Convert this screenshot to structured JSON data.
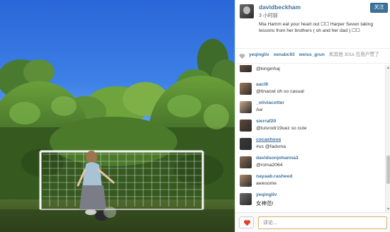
{
  "post": {
    "username": "davidbeckham",
    "time_ago": "3 小时前",
    "follow_label": "关注",
    "caption": "Mia Hamm eat your heart out ☐☐ Harper Seven taking lessons from her brothers ( oh and her dad ) ☐☐"
  },
  "likes": {
    "users": [
      "yeqingliv",
      "xenabc93",
      "weiss_grun"
    ],
    "summary": "和其他 301k 位用户赞了"
  },
  "comments": [
    {
      "user": "",
      "text": "@kinginhaj",
      "avatar_color": "#7a5a48"
    },
    {
      "user": "aacl8",
      "text": "@tinacwl oh so casual",
      "avatar_color": "#a07a5a"
    },
    {
      "user": "_oliviacotter",
      "text": "Aw",
      "avatar_color": "#c9a98a"
    },
    {
      "user": "sierraf20",
      "text": "@luisrodr19uez so cute",
      "avatar_color": "#5f4a3a"
    },
    {
      "user": "cocaxhova",
      "text": "#us @fadxma",
      "avatar_color": "#3a3a3a"
    },
    {
      "user": "davidsonjohanna3",
      "text": "@roma2064",
      "avatar_color": "#8f6f55"
    },
    {
      "user": "nayaab.rasheed",
      "text": "awesome",
      "avatar_color": "#b08a6e"
    },
    {
      "user": "yeqingliv",
      "text": "女神范!",
      "avatar_color": "#6c6c6c"
    }
  ],
  "comment_box": {
    "placeholder": "评论..."
  },
  "colors": {
    "link_blue": "#3f729b",
    "follow_bg": "#3f729b",
    "heart_red": "#e0422b"
  },
  "icons": {
    "like": "heart-icon",
    "like_button": "heart-filled-icon",
    "avatar": "profile-photo"
  }
}
